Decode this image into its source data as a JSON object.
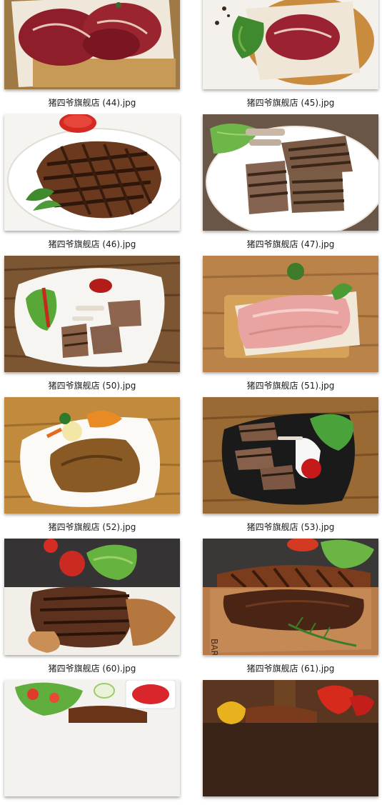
{
  "files": [
    {
      "name": "猪四爷旗舰店 (44).jpg",
      "subject": "raw-beef-on-board"
    },
    {
      "name": "猪四爷旗舰店 (45).jpg",
      "subject": "raw-ribeye-on-board"
    },
    {
      "name": "猪四爷旗舰店 (46).jpg",
      "subject": "grilled-steak-plate"
    },
    {
      "name": "猪四爷旗舰店 (47).jpg",
      "subject": "grilled-lamb-chops-plate"
    },
    {
      "name": "猪四爷旗舰店 (50).jpg",
      "subject": "lamb-chops-on-wood"
    },
    {
      "name": "猪四爷旗舰店 (51).jpg",
      "subject": "raw-pork-on-board"
    },
    {
      "name": "猪四爷旗舰店 (52).jpg",
      "subject": "steak-with-gravy"
    },
    {
      "name": "猪四爷旗舰店 (53).jpg",
      "subject": "lamb-chops-black-plate"
    },
    {
      "name": "猪四爷旗舰店 (60).jpg",
      "subject": "steak-with-salad"
    },
    {
      "name": "猪四爷旗舰店 (61).jpg",
      "subject": "roast-beef-on-board"
    },
    {
      "name": "",
      "subject": "salad-and-meat"
    },
    {
      "name": "",
      "subject": "peppers-and-meat"
    }
  ]
}
